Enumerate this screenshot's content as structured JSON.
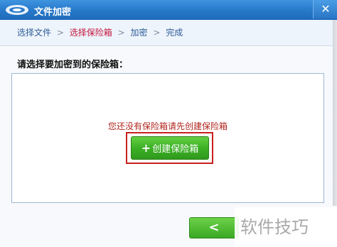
{
  "window": {
    "title": "文件加密",
    "close_glyph": "✕"
  },
  "breadcrumb": {
    "steps": [
      "选择文件",
      "选择保险箱",
      "加密",
      "完成"
    ],
    "separator": ">",
    "active_index": 1
  },
  "prompt": "请选择要加密到的保险箱：",
  "vault_panel": {
    "empty_message": "您还没有保险箱请先创建保险箱",
    "create_button": {
      "icon": "+",
      "label": "创建保险箱"
    }
  },
  "footer": {
    "back_glyph": "<"
  },
  "watermark": "软件技巧",
  "colors": {
    "titlebar": "#2a7ccd",
    "active_step": "#c4163e",
    "message": "#b0261e",
    "button_green": "#3cb026",
    "highlight": "#c8201c"
  }
}
